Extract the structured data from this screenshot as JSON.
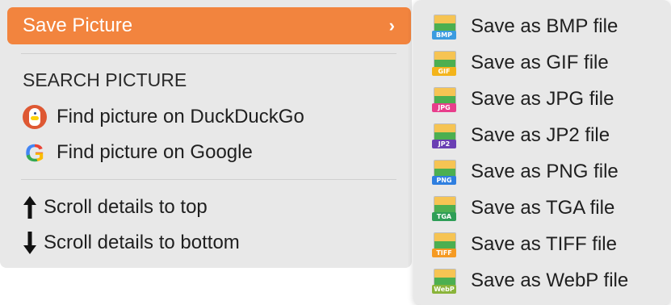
{
  "main_menu": {
    "selected_item": {
      "label": "Save Picture",
      "chevron": "›",
      "icon": "chevron-right-icon"
    },
    "search_heading": "SEARCH PICTURE",
    "search_items": [
      {
        "label": "Find picture on DuckDuckGo",
        "icon": "duckduckgo-icon"
      },
      {
        "label": "Find picture on Google",
        "icon": "google-icon"
      }
    ],
    "scroll_items": [
      {
        "label": "Scroll details to top",
        "icon": "arrow-up-icon",
        "glyph": "🠕"
      },
      {
        "label": "Scroll details to bottom",
        "icon": "arrow-down-icon",
        "glyph": "🠗"
      }
    ]
  },
  "submenu": {
    "items": [
      {
        "label": "Save as BMP file",
        "tag": "BMP",
        "tag_color": "#3b9be0",
        "icon": "bmp-file-icon"
      },
      {
        "label": "Save as GIF file",
        "tag": "GIF",
        "tag_color": "#f3b41b",
        "icon": "gif-file-icon"
      },
      {
        "label": "Save as JPG file",
        "tag": "JPG",
        "tag_color": "#e83e8c",
        "icon": "jpg-file-icon"
      },
      {
        "label": "Save as JP2 file",
        "tag": "JP2",
        "tag_color": "#6a3fb3",
        "icon": "jp2-file-icon"
      },
      {
        "label": "Save as PNG file",
        "tag": "PNG",
        "tag_color": "#2f7fe0",
        "icon": "png-file-icon"
      },
      {
        "label": "Save as TGA file",
        "tag": "TGA",
        "tag_color": "#2e9e57",
        "icon": "tga-file-icon"
      },
      {
        "label": "Save as TIFF file",
        "tag": "TIFF",
        "tag_color": "#f59a23",
        "icon": "tiff-file-icon"
      },
      {
        "label": "Save as WebP file",
        "tag": "WebP",
        "tag_color": "#8ab43a",
        "icon": "webp-file-icon"
      }
    ]
  },
  "colors": {
    "accent": "#f2843e",
    "menu_bg": "#e8e8e8"
  }
}
